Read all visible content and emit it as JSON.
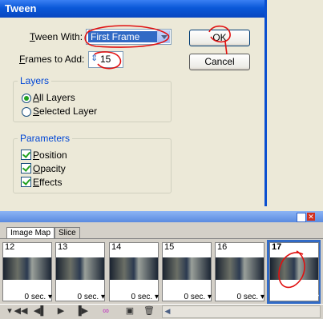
{
  "dialog": {
    "title": "Tween",
    "tween_with_label_prefix": "",
    "tween_with_label_u": "T",
    "tween_with_label_rest": "ween With:",
    "tween_with_value": "First Frame",
    "frames_label_u": "F",
    "frames_label_rest": "rames to Add:",
    "frames_value": "15",
    "ok_label": "OK",
    "cancel_label": "Cancel",
    "layers_group": "Layers",
    "layers_options": [
      {
        "u": "A",
        "rest": "ll Layers",
        "selected": true
      },
      {
        "u": "S",
        "rest": "elected Layer",
        "selected": false
      }
    ],
    "params_group": "Parameters",
    "params": [
      {
        "u": "P",
        "rest": "osition",
        "checked": true
      },
      {
        "u": "O",
        "rest": "pacity",
        "checked": true
      },
      {
        "u": "E",
        "rest": "ffects",
        "checked": true
      }
    ]
  },
  "panel": {
    "tabs": [
      "Image Map",
      "Slice"
    ],
    "frames": [
      {
        "num": "12",
        "delay": "0 sec."
      },
      {
        "num": "13",
        "delay": "0 sec."
      },
      {
        "num": "14",
        "delay": "0 sec."
      },
      {
        "num": "15",
        "delay": "0 sec."
      },
      {
        "num": "16",
        "delay": "0 sec."
      },
      {
        "num": "17",
        "delay": "0 sec."
      }
    ],
    "selected_frame": "17"
  }
}
